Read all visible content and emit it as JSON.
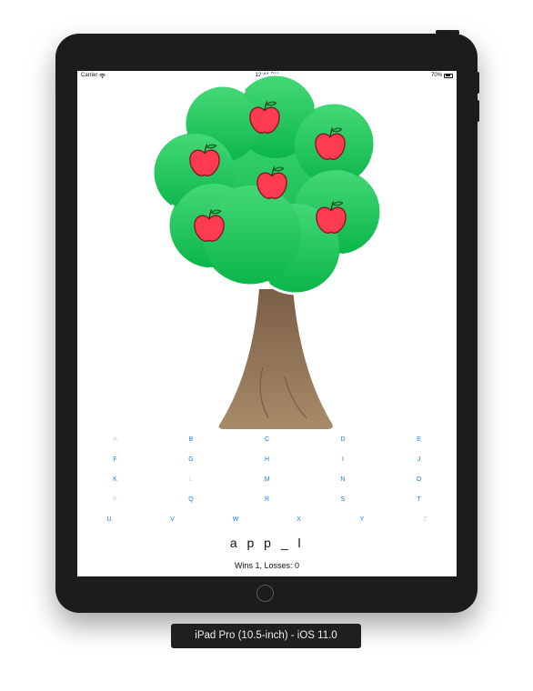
{
  "status_bar": {
    "carrier": "Carrier",
    "time": "12:44 PM",
    "battery": "70%",
    "battery_level": 0.7
  },
  "keyboard": {
    "rows": [
      [
        {
          "letter": "A",
          "enabled": false
        },
        {
          "letter": "B",
          "enabled": true
        },
        {
          "letter": "C",
          "enabled": true
        },
        {
          "letter": "D",
          "enabled": true
        },
        {
          "letter": "E",
          "enabled": true
        }
      ],
      [
        {
          "letter": "F",
          "enabled": true
        },
        {
          "letter": "G",
          "enabled": true
        },
        {
          "letter": "H",
          "enabled": true
        },
        {
          "letter": "I",
          "enabled": true
        },
        {
          "letter": "J",
          "enabled": true
        }
      ],
      [
        {
          "letter": "K",
          "enabled": true
        },
        {
          "letter": "L",
          "enabled": false
        },
        {
          "letter": "M",
          "enabled": true
        },
        {
          "letter": "N",
          "enabled": true
        },
        {
          "letter": "O",
          "enabled": true
        }
      ],
      [
        {
          "letter": "P",
          "enabled": false
        },
        {
          "letter": "Q",
          "enabled": true
        },
        {
          "letter": "R",
          "enabled": true
        },
        {
          "letter": "S",
          "enabled": true
        },
        {
          "letter": "T",
          "enabled": true
        }
      ],
      [
        {
          "letter": "U",
          "enabled": true
        },
        {
          "letter": "V",
          "enabled": true
        },
        {
          "letter": "W",
          "enabled": true
        },
        {
          "letter": "X",
          "enabled": true
        },
        {
          "letter": "Y",
          "enabled": true
        },
        {
          "letter": "Z",
          "enabled": false
        }
      ]
    ]
  },
  "game": {
    "word": "a p p _ l",
    "score": "Wins 1, Losses: 0",
    "apples_remaining": 6
  },
  "simulator": {
    "device_label": "iPad Pro (10.5-inch) - iOS 11.0"
  },
  "colors": {
    "accent": "#1a7cf5",
    "disabled": "#cfcfcf",
    "apple": "#ff3b52",
    "leaves_top": "#43d877",
    "leaves_bottom": "#0cb64a",
    "trunk_top": "#7a5e46",
    "trunk_bottom": "#a88b68"
  }
}
